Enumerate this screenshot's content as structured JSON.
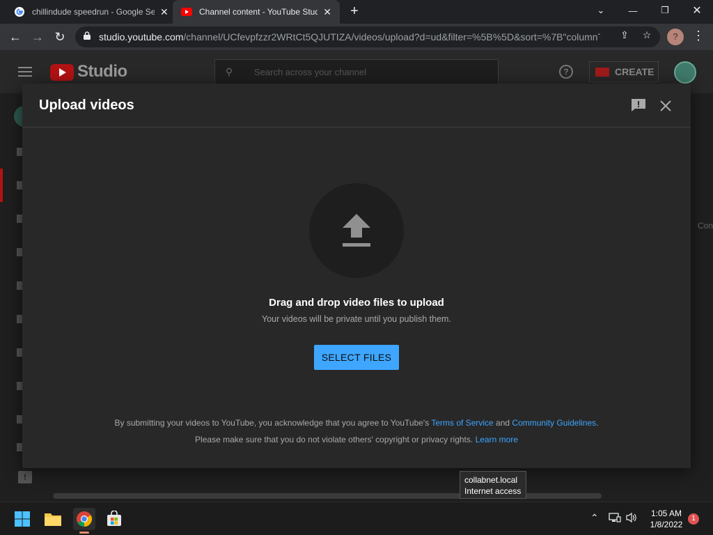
{
  "browser": {
    "tabs": [
      {
        "title": "chillindude speedrun - Google Se",
        "active": false
      },
      {
        "title": "Channel content - YouTube Studi",
        "active": true
      }
    ],
    "new_tab": "+",
    "address": {
      "host": "studio.youtube.com",
      "path": "/channel/UCfevpfzzr2WRtCt5QJUTIZA/videos/upload?d=ud&filter=%5B%5D&sort=%7B\"columnT..."
    },
    "profile_initial": "?"
  },
  "studio": {
    "brand": "Studio",
    "search_placeholder": "Search across your channel",
    "create_label": "CREATE",
    "help_label": "?",
    "background_text": "Con"
  },
  "dialog": {
    "title": "Upload videos",
    "drag_text": "Drag and drop video files to upload",
    "private_text": "Your videos will be private until you publish them.",
    "select_button": "SELECT FILES",
    "legal_line1_prefix": "By submitting your videos to YouTube, you acknowledge that you agree to YouTube's",
    "terms_link": "Terms of Service",
    "and": "and",
    "guidelines_link": "Community Guidelines",
    "period": ".",
    "legal_line2_prefix": "Please make sure that you do not violate others' copyright or privacy rights.",
    "learn_more_link": "Learn more"
  },
  "tooltip": {
    "line1": "collabnet.local",
    "line2": "Internet access"
  },
  "taskbar": {
    "time": "1:05 AM",
    "date": "1/8/2022",
    "notification_count": "1"
  },
  "colors": {
    "accent_blue": "#3ea6ff",
    "youtube_red": "#ff0000",
    "dialog_bg": "#282828"
  }
}
